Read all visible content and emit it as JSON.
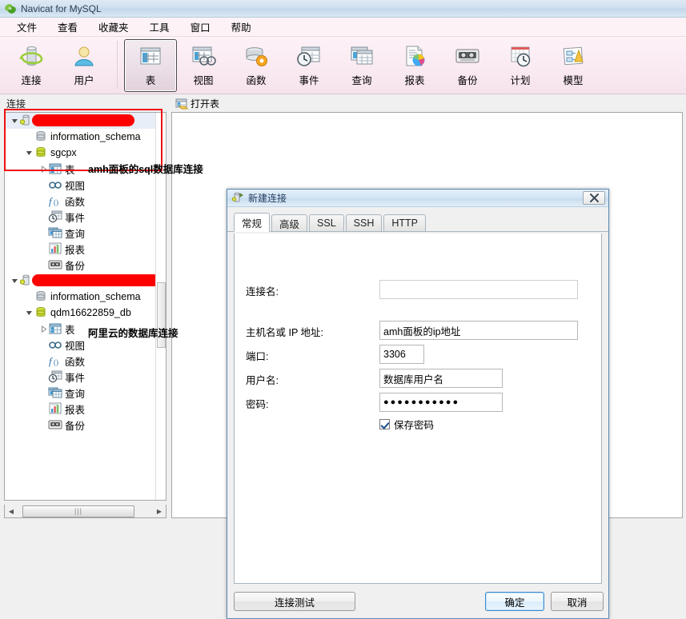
{
  "window": {
    "title": "Navicat for MySQL",
    "icon": "navicat-logo-icon"
  },
  "menubar": {
    "items": [
      {
        "label": "文件",
        "name": "menu-file"
      },
      {
        "label": "查看",
        "name": "menu-view"
      },
      {
        "label": "收藏夹",
        "name": "menu-favorites"
      },
      {
        "label": "工具",
        "name": "menu-tools"
      },
      {
        "label": "窗口",
        "name": "menu-window"
      },
      {
        "label": "帮助",
        "name": "menu-help"
      }
    ]
  },
  "toolbar": {
    "groups": [
      {
        "buttons": [
          {
            "label": "连接",
            "icon": "connection-icon",
            "selected": false
          },
          {
            "label": "用户",
            "icon": "user-icon",
            "selected": false
          }
        ]
      },
      {
        "buttons": [
          {
            "label": "表",
            "icon": "table-icon",
            "selected": true
          },
          {
            "label": "视图",
            "icon": "view-icon",
            "selected": false
          },
          {
            "label": "函数",
            "icon": "function-icon",
            "selected": false
          },
          {
            "label": "事件",
            "icon": "event-icon",
            "selected": false
          },
          {
            "label": "查询",
            "icon": "query-icon",
            "selected": false
          },
          {
            "label": "报表",
            "icon": "report-icon",
            "selected": false
          },
          {
            "label": "备份",
            "icon": "backup-icon",
            "selected": false
          },
          {
            "label": "计划",
            "icon": "schedule-icon",
            "selected": false
          },
          {
            "label": "模型",
            "icon": "model-icon",
            "selected": false
          }
        ]
      }
    ]
  },
  "left_pane": {
    "header": "连接",
    "scrollbar_thumb_glyph": "|||",
    "tree": [
      {
        "label": "",
        "redacted": true,
        "icon": "server-connection-icon",
        "indent": 0,
        "twist": "expanded",
        "selected": true
      },
      {
        "label": "information_schema",
        "icon": "database-gray-icon",
        "indent": 1,
        "twist": "none"
      },
      {
        "label": "sgcpx",
        "icon": "database-green-icon",
        "indent": 1,
        "twist": "expanded"
      },
      {
        "label": "表",
        "icon": "table-blue-icon",
        "indent": 2,
        "twist": "collapsed"
      },
      {
        "label": "视图",
        "icon": "view-glasses-icon",
        "indent": 2,
        "twist": "none"
      },
      {
        "label": "函数",
        "icon": "function-fx-icon",
        "indent": 2,
        "twist": "none"
      },
      {
        "label": "事件",
        "icon": "event-clock-icon",
        "indent": 2,
        "twist": "none"
      },
      {
        "label": "查询",
        "icon": "query-window-icon",
        "indent": 2,
        "twist": "none"
      },
      {
        "label": "报表",
        "icon": "report-chart-icon",
        "indent": 2,
        "twist": "none"
      },
      {
        "label": "备份",
        "icon": "backup-tape-icon",
        "indent": 2,
        "twist": "none"
      },
      {
        "label": "",
        "redacted": true,
        "icon": "server-connection-icon",
        "indent": 0,
        "twist": "expanded"
      },
      {
        "label": "information_schema",
        "icon": "database-gray-icon",
        "indent": 1,
        "twist": "none"
      },
      {
        "label": "qdm16622859_db",
        "icon": "database-green-icon",
        "indent": 1,
        "twist": "expanded"
      },
      {
        "label": "表",
        "icon": "table-blue-icon",
        "indent": 2,
        "twist": "collapsed"
      },
      {
        "label": "视图",
        "icon": "view-glasses-icon",
        "indent": 2,
        "twist": "none"
      },
      {
        "label": "函数",
        "icon": "function-fx-icon",
        "indent": 2,
        "twist": "none"
      },
      {
        "label": "事件",
        "icon": "event-clock-icon",
        "indent": 2,
        "twist": "none"
      },
      {
        "label": "查询",
        "icon": "query-window-icon",
        "indent": 2,
        "twist": "none"
      },
      {
        "label": "报表",
        "icon": "report-chart-icon",
        "indent": 2,
        "twist": "none"
      },
      {
        "label": "备份",
        "icon": "backup-tape-icon",
        "indent": 2,
        "twist": "none"
      }
    ]
  },
  "annotations": {
    "box_color": "#ee1111",
    "labels": [
      {
        "text": "amh面板的sql数据库连接",
        "name": "annotation-amh-connection"
      },
      {
        "text": "阿里云的数据库连接",
        "name": "annotation-aliyun-connection"
      }
    ]
  },
  "right_pane": {
    "toolbar": [
      {
        "label": "打开表",
        "icon": "open-table-icon"
      }
    ]
  },
  "dialog": {
    "title": "新建连接",
    "icon": "new-connection-icon",
    "close_label": "✕",
    "tabs": [
      {
        "label": "常规",
        "active": true
      },
      {
        "label": "高级",
        "active": false
      },
      {
        "label": "SSL",
        "active": false
      },
      {
        "label": "SSH",
        "active": false
      },
      {
        "label": "HTTP",
        "active": false
      }
    ],
    "fields": [
      {
        "label": "连接名:",
        "value": "",
        "name": "connection-name"
      },
      {
        "label": "主机名或 IP 地址:",
        "value": "amh面板的ip地址",
        "name": "host-address"
      },
      {
        "label": "端口:",
        "value": "3306",
        "name": "port"
      },
      {
        "label": "用户名:",
        "value": "数据库用户名",
        "name": "username"
      },
      {
        "label": "密码:",
        "value": "●●●●●●●●●●●",
        "name": "password"
      }
    ],
    "save_password": {
      "label": "保存密码",
      "checked": true
    },
    "buttons": {
      "test": "连接测试",
      "ok": "确定",
      "cancel": "取消"
    }
  }
}
